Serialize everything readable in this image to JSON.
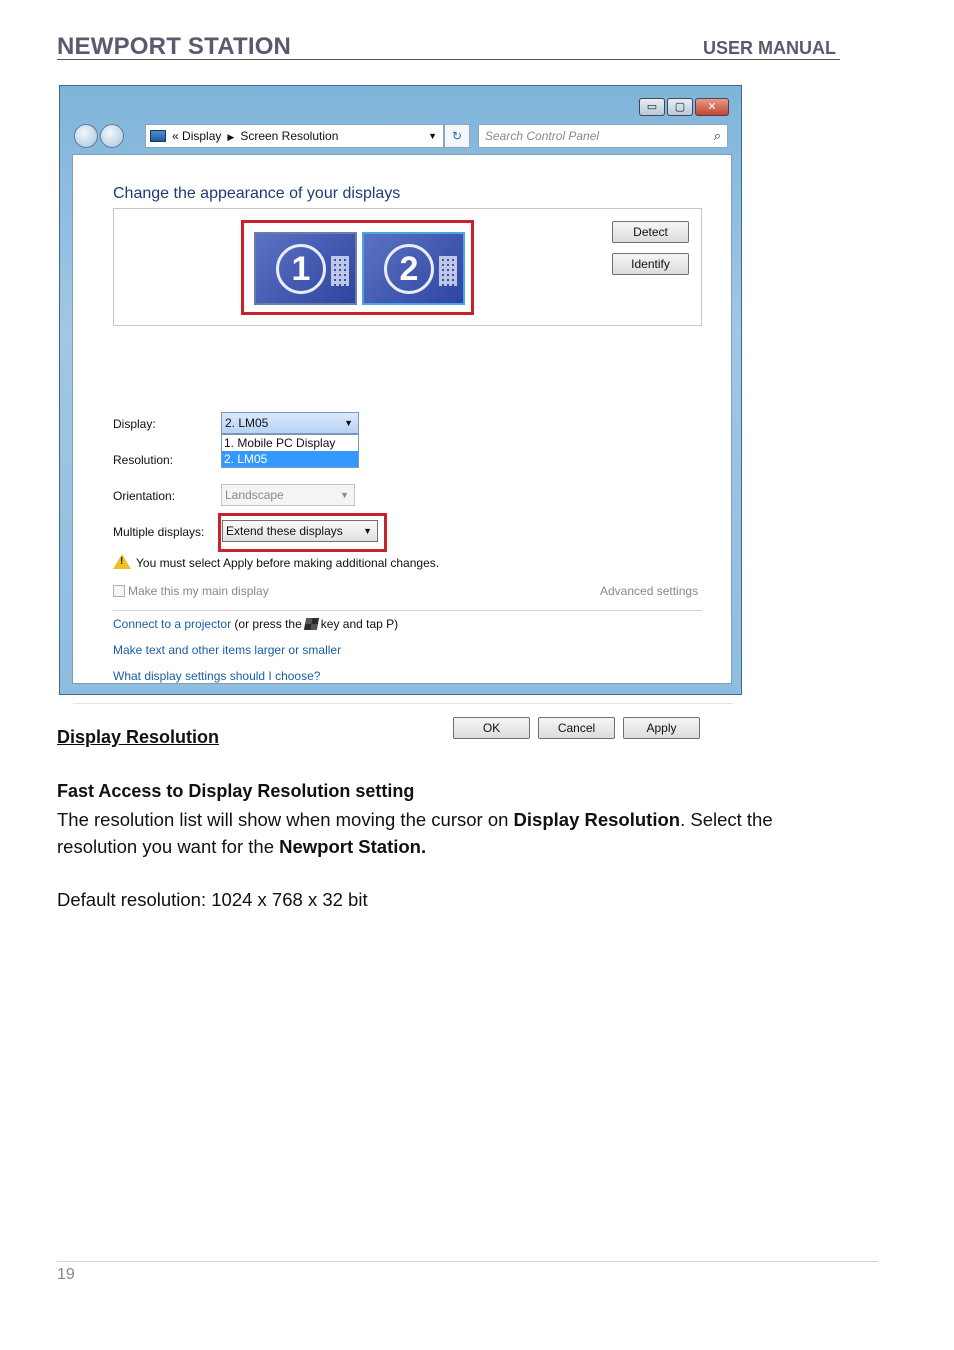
{
  "header": {
    "title": "NEWPORT STATION",
    "right": "USER MANUAL"
  },
  "window": {
    "caption": {
      "minimize": "▭",
      "maximize": "▢",
      "close": "✕"
    },
    "address": {
      "prefix": "«",
      "crumb1": "Display",
      "crumb2": "Screen Resolution"
    },
    "search_placeholder": "Search Control Panel",
    "heading": "Change the appearance of your displays",
    "monitors": [
      {
        "number": "1"
      },
      {
        "number": "2"
      }
    ],
    "detect_label": "Detect",
    "identify_label": "Identify",
    "display_label": "Display:",
    "display_value": "2. LM05",
    "display_options": [
      "1. Mobile PC Display",
      "2. LM05"
    ],
    "resolution_label": "Resolution:",
    "orientation_label": "Orientation:",
    "orientation_value": "Landscape",
    "multiple_label": "Multiple displays:",
    "multiple_value": "Extend these displays",
    "warning_text": "You must select Apply before making additional changes.",
    "main_display_label": "Make this my main display",
    "advanced_label": "Advanced settings",
    "link_projector": "Connect to a projector",
    "link_projector_suffix_a": "(or press the",
    "link_projector_suffix_b": "key and tap P)",
    "link_text_size": "Make text and other items larger or smaller",
    "link_which": "What display settings should I choose?",
    "ok_label": "OK",
    "cancel_label": "Cancel",
    "apply_label": "Apply"
  },
  "doc": {
    "section_title": "Display Resolution",
    "sub_title": "Fast Access to Display Resolution setting",
    "para_a": "The resolution list will show when moving the cursor on ",
    "para_b": "Display Resolution",
    "para_c": ".  Select the resolution you want for the ",
    "para_d": "Newport Station.",
    "default_text": "Default resolution: 1024 x 768 x 32 bit"
  },
  "page_number": "19"
}
